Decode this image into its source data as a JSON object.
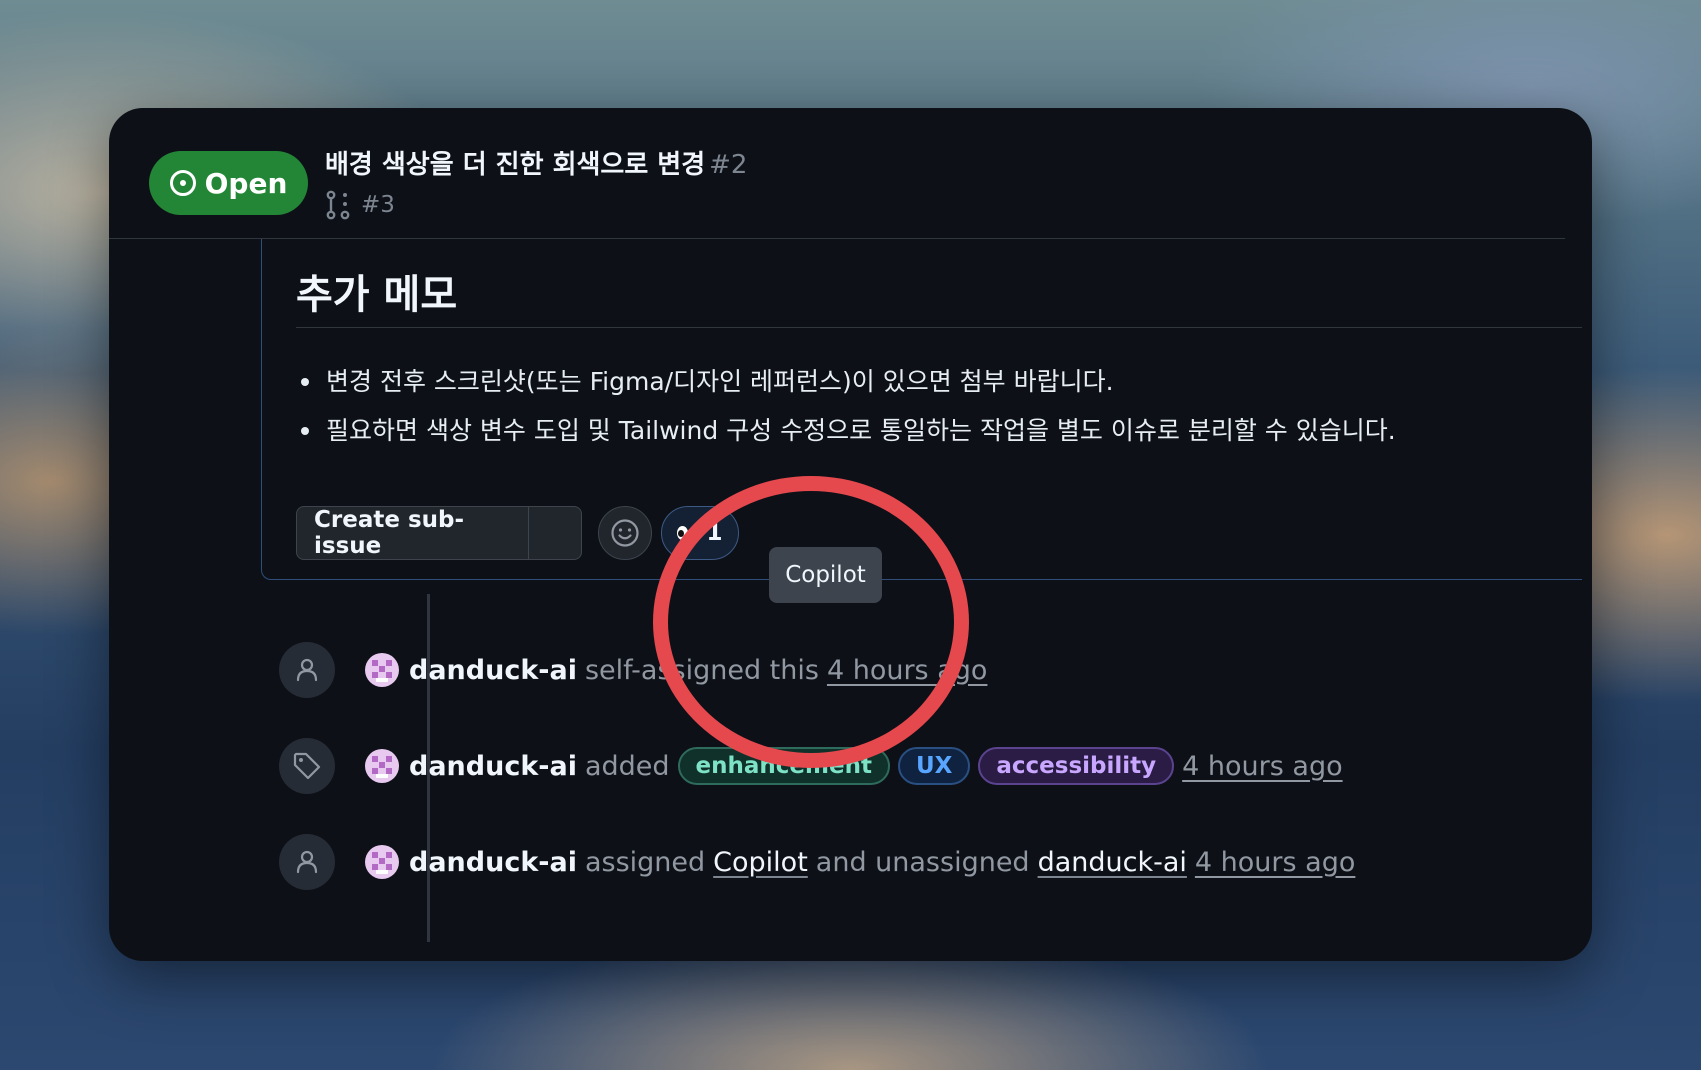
{
  "issue": {
    "status": "Open",
    "title": "배경 색상을 더 진한 회색으로 변경",
    "number": "#2",
    "linked_pr": "#3"
  },
  "comment": {
    "heading": "추가 메모",
    "bullets": [
      "변경 전후 스크린샷(또는 Figma/디자인 레퍼런스)이 있으면 첨부 바랍니다.",
      "필요하면 색상 변수 도입 및 Tailwind 구성 수정으로 통일하는 작업을 별도 이슈로 분리할 수 있습니다."
    ],
    "create_sub_issue_label": "Create sub-issue",
    "reaction_count": "1",
    "tooltip": "Copilot"
  },
  "timeline": [
    {
      "icon": "person-icon",
      "actor": "danduck-ai",
      "action": "self-assigned this",
      "time": "4 hours ago"
    },
    {
      "icon": "tag-icon",
      "actor": "danduck-ai",
      "action": "added",
      "labels": [
        {
          "name": "enhancement",
          "color": "#7ee2c7",
          "bg": "#10302a",
          "border": "#2f6b5c"
        },
        {
          "name": "UX",
          "color": "#58a6ff",
          "bg": "#0f2340",
          "border": "#2a4f82"
        },
        {
          "name": "accessibility",
          "color": "#c9a6ff",
          "bg": "#2a1c44",
          "border": "#5b4390"
        }
      ],
      "time": "4 hours ago"
    },
    {
      "icon": "person-icon",
      "actor": "danduck-ai",
      "action1": "assigned",
      "target1": "Copilot",
      "action2": "and unassigned",
      "target2": "danduck-ai",
      "time": "4 hours ago"
    }
  ],
  "colors": {
    "open_badge": "#238636",
    "annotation_circle": "#e5484d",
    "panel_bg": "#0d1117"
  }
}
